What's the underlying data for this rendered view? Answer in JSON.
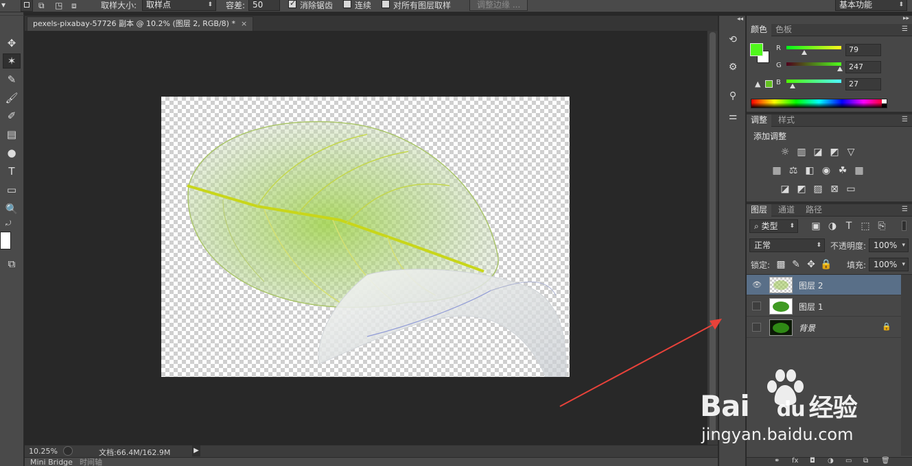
{
  "options_bar": {
    "sample_size_label": "取样大小:",
    "sample_size_value": "取样点",
    "tolerance_label": "容差:",
    "tolerance_value": "50",
    "antialias_label": "消除锯齿",
    "contiguous_label": "连续",
    "sample_all_label": "对所有图层取样",
    "refine_edge_label": "调整边缘 ...",
    "workspace_value": "基本功能"
  },
  "document": {
    "tab_title": "pexels-pixabay-57726 副本 @ 10.2% (图层 2, RGB/8) *",
    "close_glyph": "×"
  },
  "status": {
    "zoom": "10.25%",
    "doc_size": "文档:66.4M/162.9M"
  },
  "bottom_tabs": [
    "Mini Bridge",
    "时间轴"
  ],
  "color_panel": {
    "tabs": [
      "颜色",
      "色板"
    ],
    "channels": [
      {
        "name": "R",
        "value": "79"
      },
      {
        "name": "G",
        "value": "247"
      },
      {
        "name": "B",
        "value": "27"
      }
    ],
    "foreground": "#4ff71b"
  },
  "adjustments_panel": {
    "tabs": [
      "调整",
      "样式"
    ],
    "title": "添加调整"
  },
  "layers_panel": {
    "tabs": [
      "图层",
      "通道",
      "路径"
    ],
    "filter_kind": "类型",
    "blend_mode": "正常",
    "opacity_label": "不透明度:",
    "opacity_value": "100%",
    "lock_label": "锁定:",
    "fill_label": "填充:",
    "fill_value": "100%",
    "layers": [
      {
        "name": "图层 2",
        "visible": true,
        "selected": true
      },
      {
        "name": "图层 1",
        "visible": false,
        "selected": false
      },
      {
        "name": "背景",
        "visible": false,
        "selected": false,
        "locked": true
      }
    ]
  },
  "watermark": {
    "brand": "Bai",
    "brand_du": "du",
    "product": "经验",
    "url": "jingyan.baidu.com"
  }
}
